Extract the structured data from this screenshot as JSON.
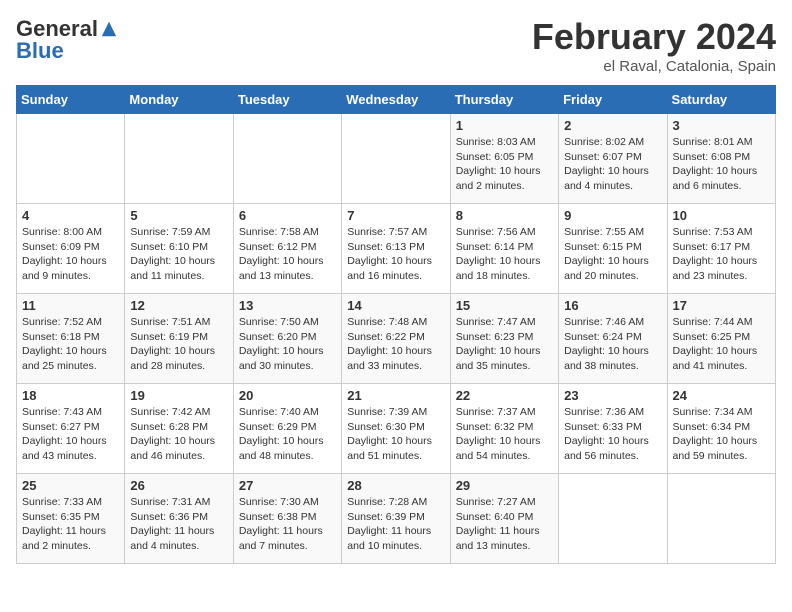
{
  "logo": {
    "general": "General",
    "blue": "Blue"
  },
  "title": "February 2024",
  "subtitle": "el Raval, Catalonia, Spain",
  "days_header": [
    "Sunday",
    "Monday",
    "Tuesday",
    "Wednesday",
    "Thursday",
    "Friday",
    "Saturday"
  ],
  "weeks": [
    [
      {
        "day": "",
        "info": ""
      },
      {
        "day": "",
        "info": ""
      },
      {
        "day": "",
        "info": ""
      },
      {
        "day": "",
        "info": ""
      },
      {
        "day": "1",
        "info": "Sunrise: 8:03 AM\nSunset: 6:05 PM\nDaylight: 10 hours\nand 2 minutes."
      },
      {
        "day": "2",
        "info": "Sunrise: 8:02 AM\nSunset: 6:07 PM\nDaylight: 10 hours\nand 4 minutes."
      },
      {
        "day": "3",
        "info": "Sunrise: 8:01 AM\nSunset: 6:08 PM\nDaylight: 10 hours\nand 6 minutes."
      }
    ],
    [
      {
        "day": "4",
        "info": "Sunrise: 8:00 AM\nSunset: 6:09 PM\nDaylight: 10 hours\nand 9 minutes."
      },
      {
        "day": "5",
        "info": "Sunrise: 7:59 AM\nSunset: 6:10 PM\nDaylight: 10 hours\nand 11 minutes."
      },
      {
        "day": "6",
        "info": "Sunrise: 7:58 AM\nSunset: 6:12 PM\nDaylight: 10 hours\nand 13 minutes."
      },
      {
        "day": "7",
        "info": "Sunrise: 7:57 AM\nSunset: 6:13 PM\nDaylight: 10 hours\nand 16 minutes."
      },
      {
        "day": "8",
        "info": "Sunrise: 7:56 AM\nSunset: 6:14 PM\nDaylight: 10 hours\nand 18 minutes."
      },
      {
        "day": "9",
        "info": "Sunrise: 7:55 AM\nSunset: 6:15 PM\nDaylight: 10 hours\nand 20 minutes."
      },
      {
        "day": "10",
        "info": "Sunrise: 7:53 AM\nSunset: 6:17 PM\nDaylight: 10 hours\nand 23 minutes."
      }
    ],
    [
      {
        "day": "11",
        "info": "Sunrise: 7:52 AM\nSunset: 6:18 PM\nDaylight: 10 hours\nand 25 minutes."
      },
      {
        "day": "12",
        "info": "Sunrise: 7:51 AM\nSunset: 6:19 PM\nDaylight: 10 hours\nand 28 minutes."
      },
      {
        "day": "13",
        "info": "Sunrise: 7:50 AM\nSunset: 6:20 PM\nDaylight: 10 hours\nand 30 minutes."
      },
      {
        "day": "14",
        "info": "Sunrise: 7:48 AM\nSunset: 6:22 PM\nDaylight: 10 hours\nand 33 minutes."
      },
      {
        "day": "15",
        "info": "Sunrise: 7:47 AM\nSunset: 6:23 PM\nDaylight: 10 hours\nand 35 minutes."
      },
      {
        "day": "16",
        "info": "Sunrise: 7:46 AM\nSunset: 6:24 PM\nDaylight: 10 hours\nand 38 minutes."
      },
      {
        "day": "17",
        "info": "Sunrise: 7:44 AM\nSunset: 6:25 PM\nDaylight: 10 hours\nand 41 minutes."
      }
    ],
    [
      {
        "day": "18",
        "info": "Sunrise: 7:43 AM\nSunset: 6:27 PM\nDaylight: 10 hours\nand 43 minutes."
      },
      {
        "day": "19",
        "info": "Sunrise: 7:42 AM\nSunset: 6:28 PM\nDaylight: 10 hours\nand 46 minutes."
      },
      {
        "day": "20",
        "info": "Sunrise: 7:40 AM\nSunset: 6:29 PM\nDaylight: 10 hours\nand 48 minutes."
      },
      {
        "day": "21",
        "info": "Sunrise: 7:39 AM\nSunset: 6:30 PM\nDaylight: 10 hours\nand 51 minutes."
      },
      {
        "day": "22",
        "info": "Sunrise: 7:37 AM\nSunset: 6:32 PM\nDaylight: 10 hours\nand 54 minutes."
      },
      {
        "day": "23",
        "info": "Sunrise: 7:36 AM\nSunset: 6:33 PM\nDaylight: 10 hours\nand 56 minutes."
      },
      {
        "day": "24",
        "info": "Sunrise: 7:34 AM\nSunset: 6:34 PM\nDaylight: 10 hours\nand 59 minutes."
      }
    ],
    [
      {
        "day": "25",
        "info": "Sunrise: 7:33 AM\nSunset: 6:35 PM\nDaylight: 11 hours\nand 2 minutes."
      },
      {
        "day": "26",
        "info": "Sunrise: 7:31 AM\nSunset: 6:36 PM\nDaylight: 11 hours\nand 4 minutes."
      },
      {
        "day": "27",
        "info": "Sunrise: 7:30 AM\nSunset: 6:38 PM\nDaylight: 11 hours\nand 7 minutes."
      },
      {
        "day": "28",
        "info": "Sunrise: 7:28 AM\nSunset: 6:39 PM\nDaylight: 11 hours\nand 10 minutes."
      },
      {
        "day": "29",
        "info": "Sunrise: 7:27 AM\nSunset: 6:40 PM\nDaylight: 11 hours\nand 13 minutes."
      },
      {
        "day": "",
        "info": ""
      },
      {
        "day": "",
        "info": ""
      }
    ]
  ]
}
